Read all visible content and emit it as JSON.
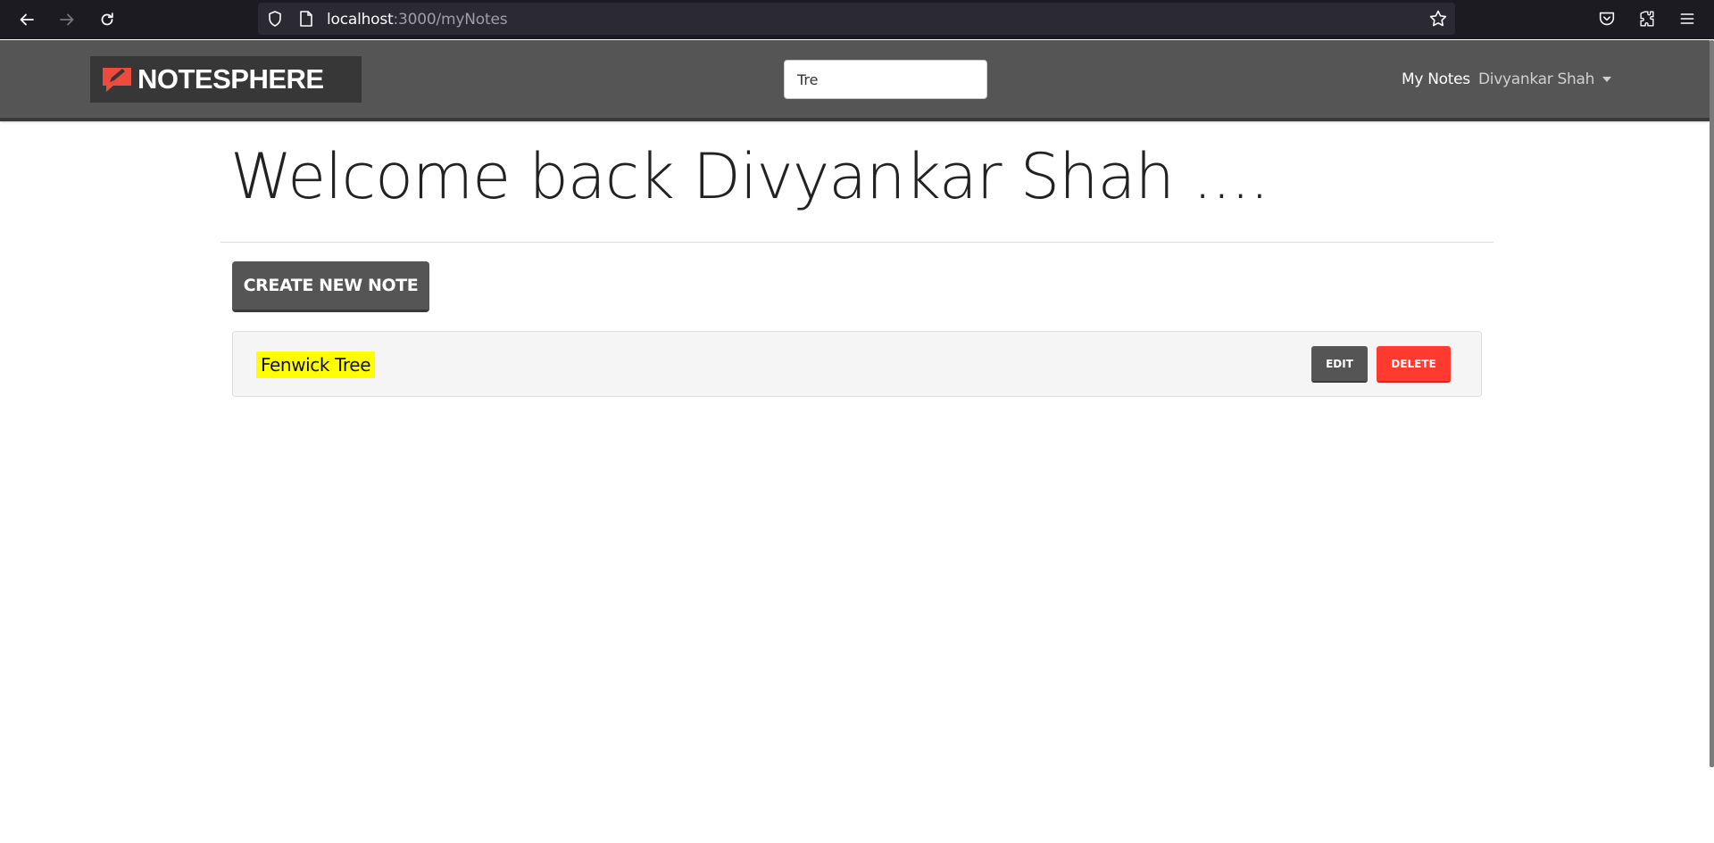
{
  "browser": {
    "url_host": "localhost",
    "url_path": ":3000/myNotes",
    "icons": [
      "back-icon",
      "forward-icon",
      "reload-icon",
      "shield-icon",
      "page-icon",
      "bookmark-star-icon",
      "pocket-icon",
      "extensions-icon",
      "menu-icon"
    ]
  },
  "navbar": {
    "brand": "NOTESPHERE",
    "search_value": "Tre",
    "my_notes_label": "My Notes",
    "user_label": "Divyankar Shah"
  },
  "main": {
    "welcome": "Welcome back Divyankar Shah ....",
    "create_label": "CREATE NEW NOTE",
    "notes": [
      {
        "title": "Fenwick Tree",
        "edit_label": "EDIT",
        "delete_label": "DELETE"
      }
    ]
  },
  "colors": {
    "navbar": "#555555",
    "delete": "#ff3b30",
    "highlight": "#ffff00",
    "brand_accent": "#ef4b3c"
  }
}
